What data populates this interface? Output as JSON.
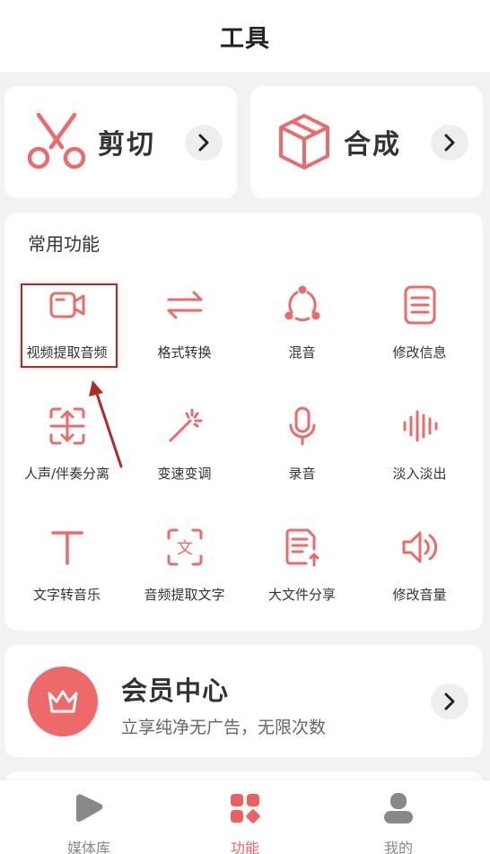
{
  "header": {
    "title": "工具"
  },
  "big_cards": {
    "cut": {
      "label": "剪切",
      "icon": "scissors-icon"
    },
    "merge": {
      "label": "合成",
      "icon": "cube-icon"
    }
  },
  "functions": {
    "section_title": "常用功能",
    "items": [
      {
        "label": "视频提取音频",
        "icon": "video-camera-icon"
      },
      {
        "label": "格式转换",
        "icon": "swap-arrows-icon"
      },
      {
        "label": "混音",
        "icon": "mix-circle-icon"
      },
      {
        "label": "修改信息",
        "icon": "document-icon"
      },
      {
        "label": "人声/伴奏分离",
        "icon": "split-icon"
      },
      {
        "label": "变速变调",
        "icon": "magic-wand-icon"
      },
      {
        "label": "录音",
        "icon": "microphone-icon"
      },
      {
        "label": "淡入淡出",
        "icon": "waveform-icon"
      },
      {
        "label": "文字转音乐",
        "icon": "text-t-icon"
      },
      {
        "label": "音频提取文字",
        "icon": "text-scan-icon"
      },
      {
        "label": "大文件分享",
        "icon": "file-share-icon"
      },
      {
        "label": "修改音量",
        "icon": "volume-icon"
      }
    ]
  },
  "member": {
    "title": "会员中心",
    "subtitle": "立享纯净无广告，无限次数",
    "icon": "crown-icon"
  },
  "tabbar": {
    "items": [
      {
        "label": "媒体库",
        "icon": "media-library-icon",
        "active": false
      },
      {
        "label": "功能",
        "icon": "functions-grid-icon",
        "active": true
      },
      {
        "label": "我的",
        "icon": "profile-icon",
        "active": false
      }
    ]
  },
  "colors": {
    "accent": "#ee6a6a",
    "text": "#333333",
    "background": "#f2f2f2",
    "annotation": "#b02a2a"
  }
}
